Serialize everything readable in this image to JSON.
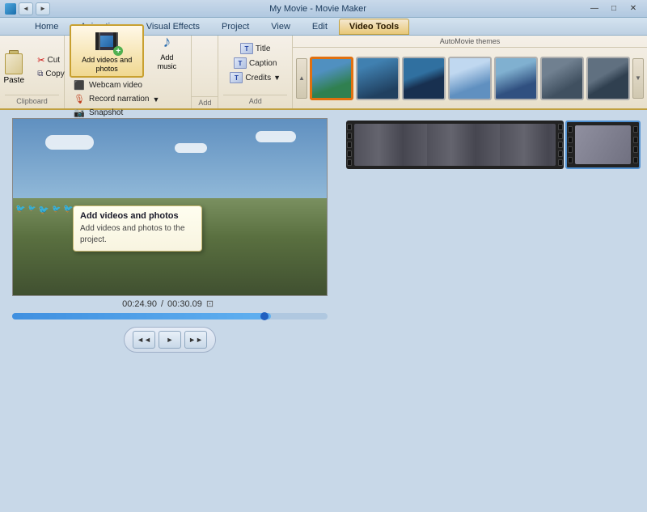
{
  "titlebar": {
    "title": "My Movie - Movie Maker",
    "back_label": "◄",
    "forward_label": "►",
    "min_label": "—",
    "max_label": "□",
    "close_label": "✕"
  },
  "tabs": [
    {
      "id": "home",
      "label": "Home"
    },
    {
      "id": "animations",
      "label": "Animations"
    },
    {
      "id": "visual_effects",
      "label": "Visual Effects"
    },
    {
      "id": "project",
      "label": "Project"
    },
    {
      "id": "view",
      "label": "View"
    },
    {
      "id": "edit",
      "label": "Edit"
    },
    {
      "id": "video_tools",
      "label": "Video Tools",
      "active": true
    }
  ],
  "ribbon": {
    "clipboard": {
      "label": "Clipboard",
      "paste_label": "Paste",
      "cut_label": "Cut",
      "copy_label": "Copy"
    },
    "add_group": {
      "label": "Add",
      "add_videos_label": "Add videos\nand photos",
      "add_music_label": "Add\nmusic",
      "webcam_label": "Webcam video",
      "narration_label": "Record narration",
      "snapshot_label": "Snapshot"
    },
    "text_group": {
      "title_label": "Title",
      "caption_label": "Caption",
      "credits_label": "Credits"
    }
  },
  "automovie": {
    "label": "AutoMovie themes",
    "scroll_up": "▲",
    "scroll_down": "▼"
  },
  "tooltip": {
    "title": "Add videos and photos",
    "description": "Add videos and photos to the project."
  },
  "preview": {
    "time_current": "00:24.90",
    "time_total": "00:30.09",
    "fullscreen_label": "⊡"
  },
  "controls": {
    "rewind_label": "◄◄",
    "play_label": "►",
    "fast_forward_label": "►►"
  }
}
